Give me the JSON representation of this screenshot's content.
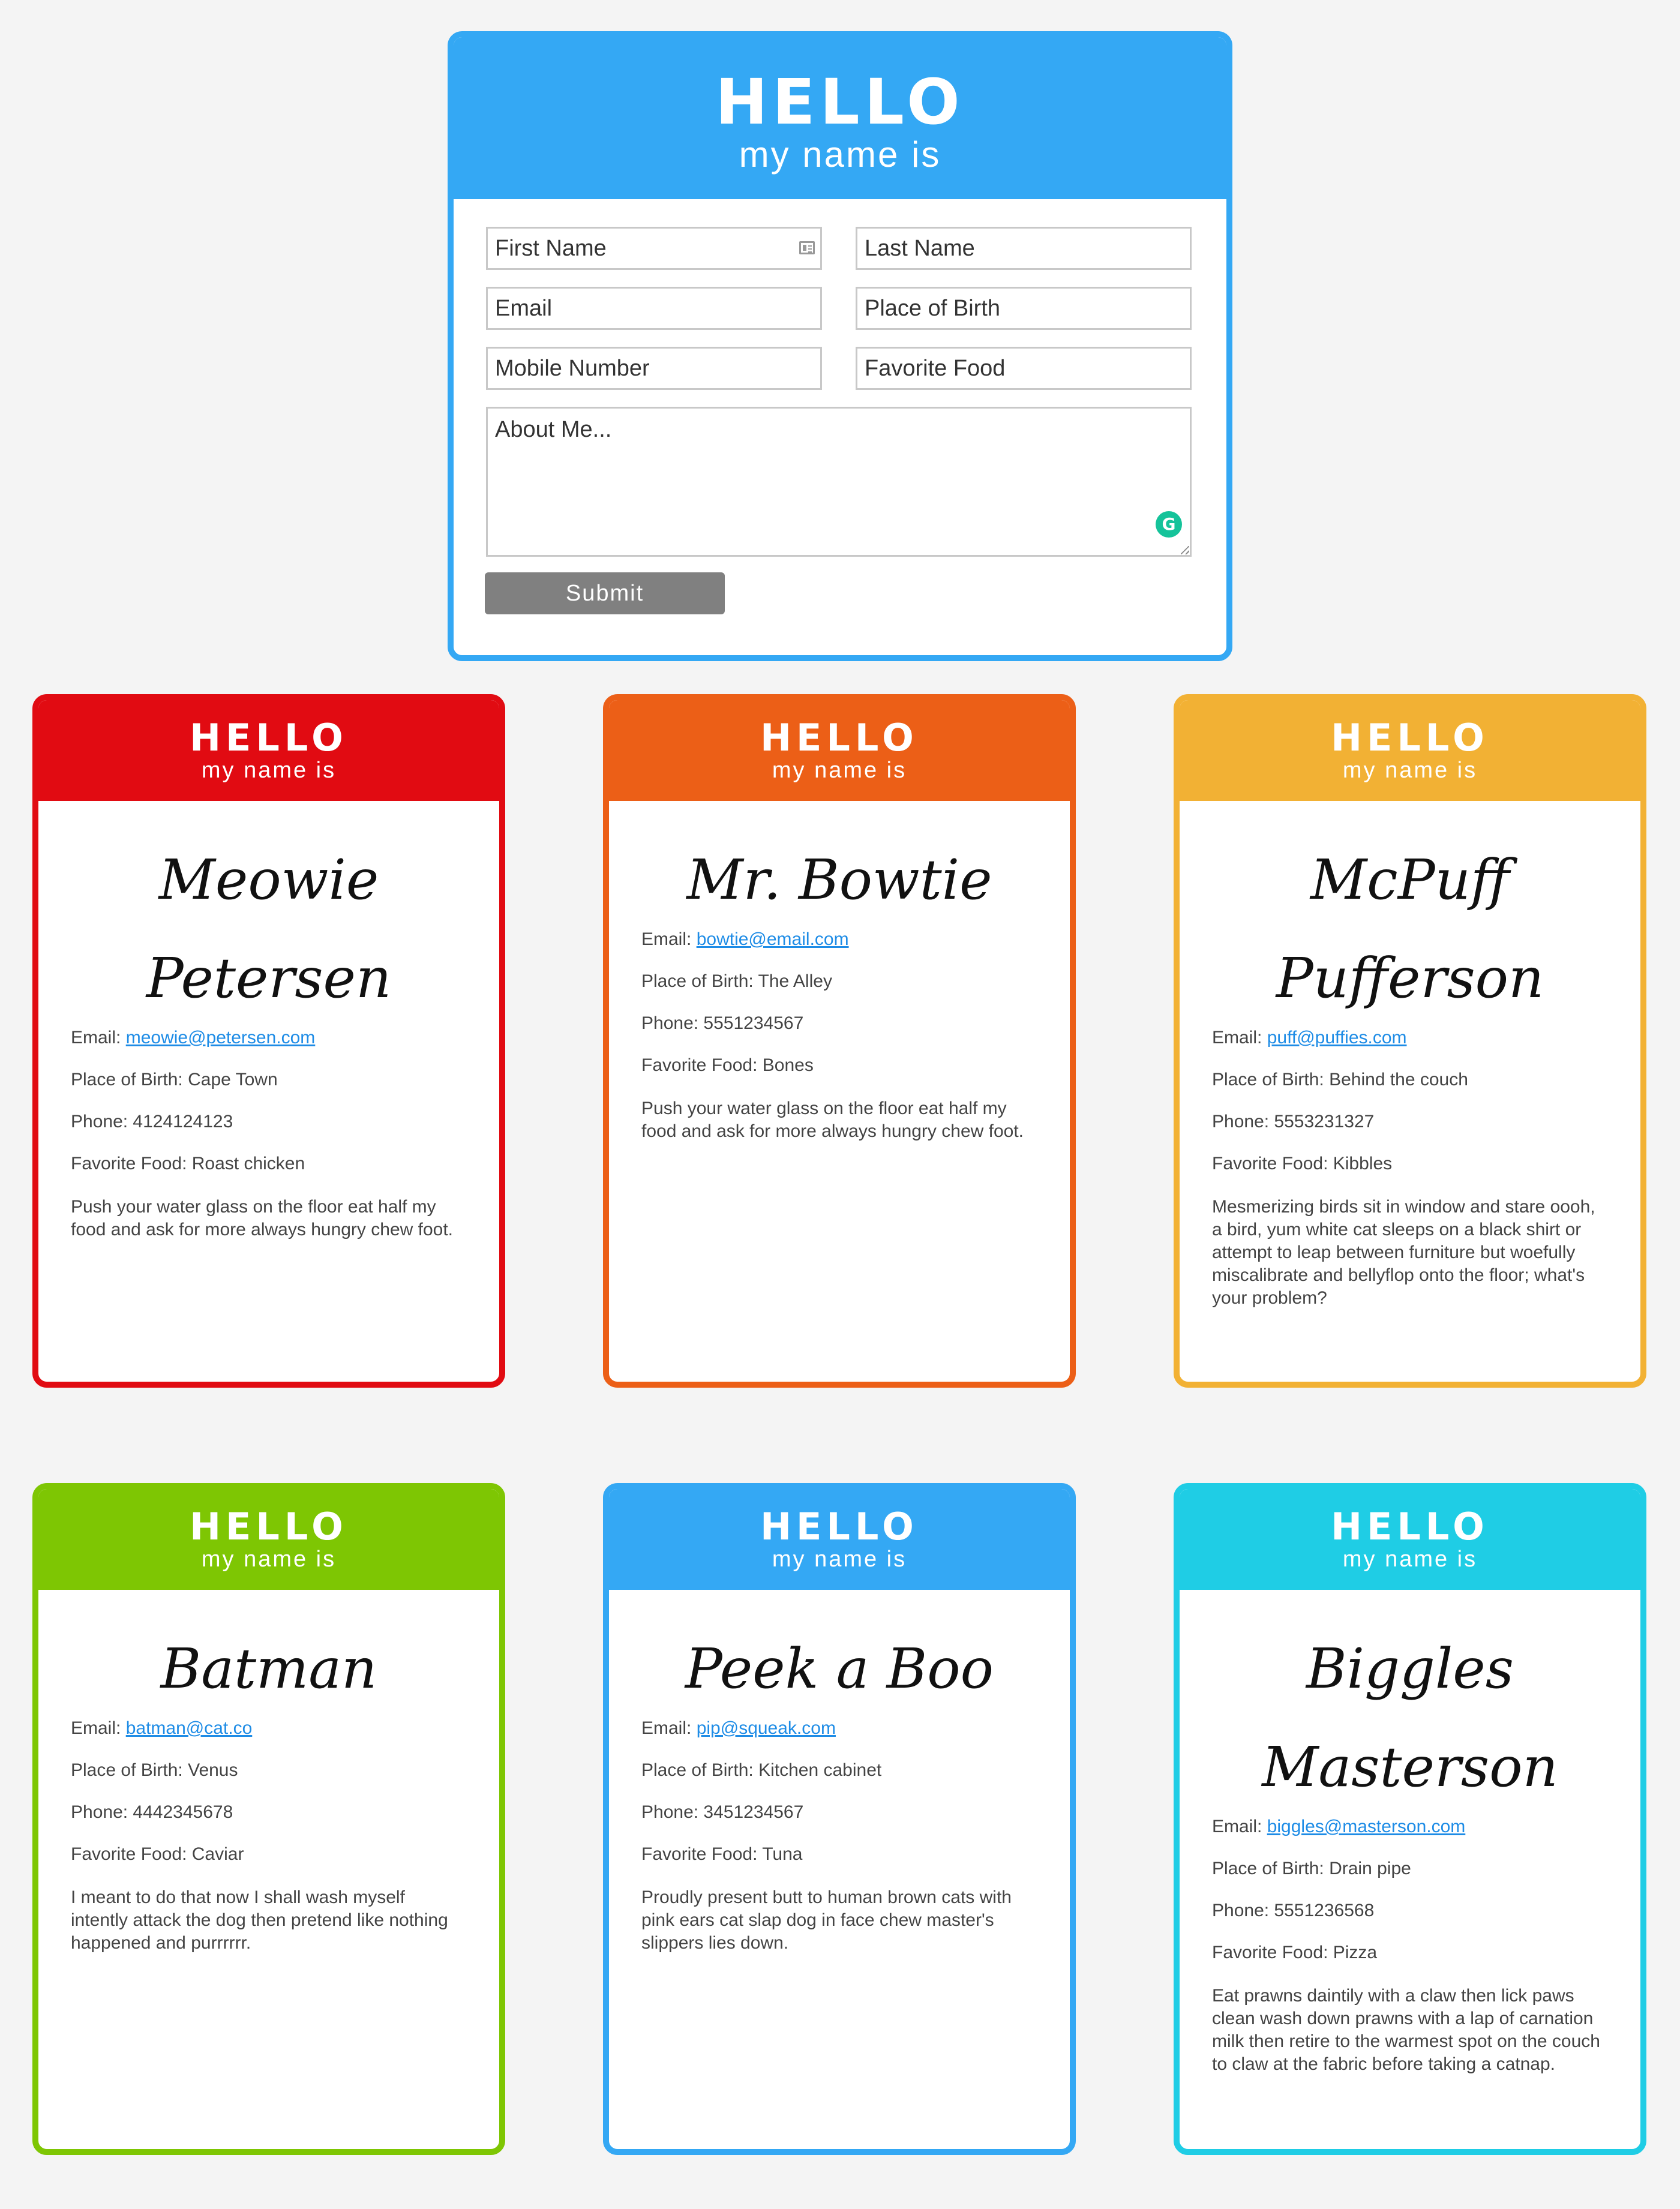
{
  "form": {
    "hello": "HELLO",
    "subtitle": "my name is",
    "first_name_placeholder": "First Name",
    "last_name_placeholder": "Last Name",
    "email_placeholder": "Email",
    "place_of_birth_placeholder": "Place of Birth",
    "mobile_placeholder": "Mobile Number",
    "favorite_food_placeholder": "Favorite Food",
    "about_placeholder": "About Me...",
    "submit_label": "Submit",
    "border_color": "#34a8f4"
  },
  "cards": [
    {
      "hello": "HELLO",
      "subtitle": "my name is",
      "name": "Meowie Petersen",
      "email_label": "Email:",
      "email": "meowie@petersen.com",
      "place_of_birth": "Place of Birth: Cape Town",
      "phone": "Phone: 4124124123",
      "favorite_food": "Favorite Food: Roast chicken",
      "about": "Push your water glass on the floor eat half my food and ask for more always hungry chew foot.",
      "color": "#e10b12"
    },
    {
      "hello": "HELLO",
      "subtitle": "my name is",
      "name": "Mr. Bowtie",
      "email_label": "Email:",
      "email": "bowtie@email.com",
      "place_of_birth": "Place of Birth: The Alley",
      "phone": "Phone: 5551234567",
      "favorite_food": "Favorite Food: Bones",
      "about": "Push your water glass on the floor eat half my food and ask for more always hungry chew foot.",
      "color": "#ec5f17"
    },
    {
      "hello": "HELLO",
      "subtitle": "my name is",
      "name": "McPuff Pufferson",
      "email_label": "Email:",
      "email": "puff@puffies.com",
      "place_of_birth": "Place of Birth: Behind the couch",
      "phone": "Phone: 5553231327",
      "favorite_food": "Favorite Food: Kibbles",
      "about": "Mesmerizing birds sit in window and stare oooh, a bird, yum white cat sleeps on a black shirt or attempt to leap between furniture but woefully miscalibrate and bellyflop onto the floor; what's your problem?",
      "color": "#f2b134"
    },
    {
      "hello": "HELLO",
      "subtitle": "my name is",
      "name": "Batman",
      "email_label": "Email:",
      "email": "batman@cat.co",
      "place_of_birth": "Place of Birth: Venus",
      "phone": "Phone: 4442345678",
      "favorite_food": "Favorite Food: Caviar",
      "about": "I meant to do that now I shall wash myself intently attack the dog then pretend like nothing happened and purrrrrr.",
      "color": "#7ec603"
    },
    {
      "hello": "HELLO",
      "subtitle": "my name is",
      "name": "Peek a Boo",
      "email_label": "Email:",
      "email": "pip@squeak.com",
      "place_of_birth": "Place of Birth: Kitchen cabinet",
      "phone": "Phone: 3451234567",
      "favorite_food": "Favorite Food: Tuna",
      "about": "Proudly present butt to human brown cats with pink ears cat slap dog in face chew master's slippers lies down.",
      "color": "#34a8f4"
    },
    {
      "hello": "HELLO",
      "subtitle": "my name is",
      "name": "Biggles Masterson",
      "email_label": "Email:",
      "email": "biggles@masterson.com",
      "place_of_birth": "Place of Birth: Drain pipe",
      "phone": "Phone: 5551236568",
      "favorite_food": "Favorite Food: Pizza",
      "about": "Eat prawns daintily with a claw then lick paws clean wash down prawns with a lap of carnation milk then retire to the warmest spot on the couch to claw at the fabric before taking a catnap.",
      "color": "#1fcde5"
    }
  ]
}
